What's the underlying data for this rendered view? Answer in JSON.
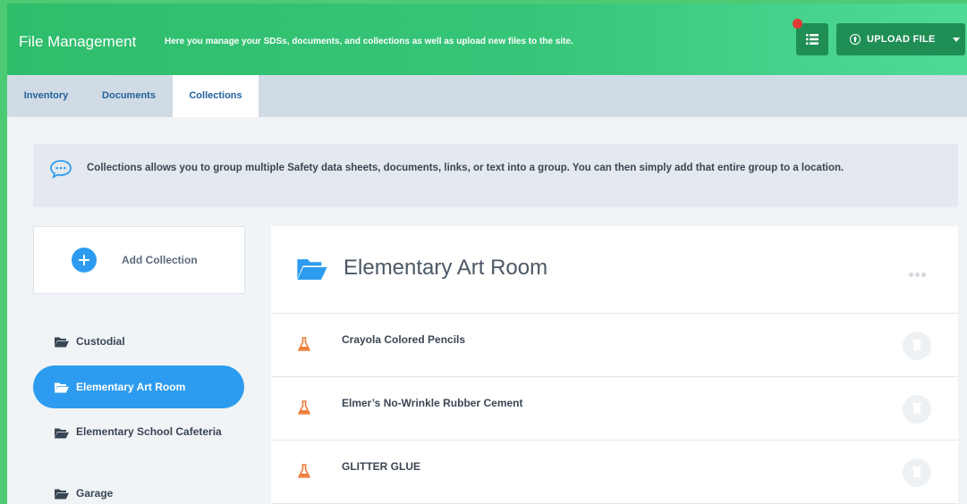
{
  "header": {
    "title": "File Management",
    "description": "Here you manage your SDSs, documents, and collections as well as upload new files to the site.",
    "upload_label": "UPLOAD FILE",
    "colors": {
      "accent": "#37c579",
      "button": "#1f8e55",
      "notification": "#e53935"
    }
  },
  "tabs": [
    {
      "label": "Inventory"
    },
    {
      "label": "Documents"
    },
    {
      "label": "Collections",
      "active": true
    }
  ],
  "info": {
    "icon": "speech-bubble-icon",
    "text": "Collections allows you to group multiple Safety data sheets, documents, links, or text into a group. You can then simply add that entire group to a location."
  },
  "sidebar": {
    "add_label": "Add Collection",
    "items": [
      {
        "label": "Custodial"
      },
      {
        "label": "Elementary Art Room",
        "active": true
      },
      {
        "label": "Elementary School Cafeteria"
      },
      {
        "label": "Garage"
      }
    ]
  },
  "main": {
    "title": "Elementary Art Room",
    "items": [
      {
        "label": "Crayola Colored Pencils"
      },
      {
        "label": "Elmer’s No-Wrinkle Rubber Cement"
      },
      {
        "label": "GLITTER GLUE"
      }
    ]
  }
}
